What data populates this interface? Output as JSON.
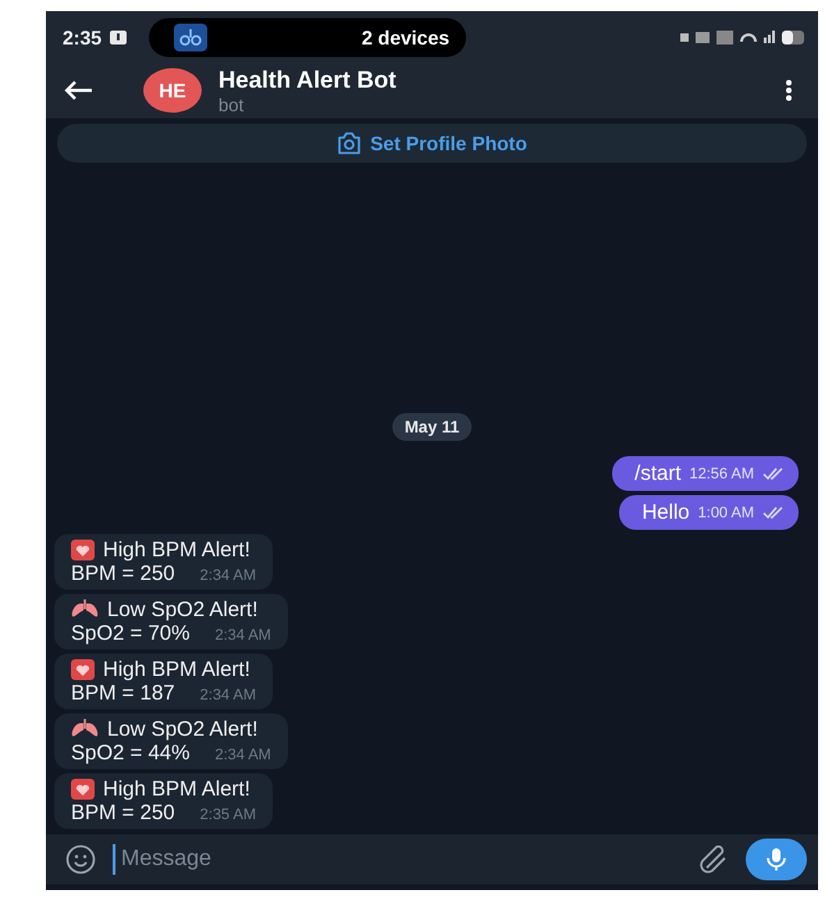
{
  "status_bar": {
    "time": "2:35",
    "devices": "2 devices"
  },
  "header": {
    "avatar": "HE",
    "title": "Health Alert Bot",
    "subtitle": "bot"
  },
  "profile_banner": "Set Profile Photo",
  "date": "May 11",
  "messages": [
    {
      "kind": "outgoing",
      "text": "/start",
      "time": "12:56 AM"
    },
    {
      "kind": "outgoing",
      "text": "Hello",
      "time": "1:00 AM"
    },
    {
      "kind": "bpm_alert",
      "title": "High BPM Alert!",
      "text": "BPM = 250",
      "time": "2:34 AM"
    },
    {
      "kind": "spo2_alert",
      "title": "Low SpO2 Alert!",
      "text": "SpO2 = 70%",
      "time": "2:34 AM"
    },
    {
      "kind": "bpm_alert",
      "title": "High BPM Alert!",
      "text": "BPM = 187",
      "time": "2:34 AM"
    },
    {
      "kind": "spo2_alert",
      "title": "Low SpO2 Alert!",
      "text": "SpO2 = 44%",
      "time": "2:34 AM"
    },
    {
      "kind": "bpm_alert",
      "title": "High BPM Alert!",
      "text": "BPM = 250",
      "time": "2:35 AM"
    }
  ],
  "composer": {
    "placeholder": "Message"
  }
}
